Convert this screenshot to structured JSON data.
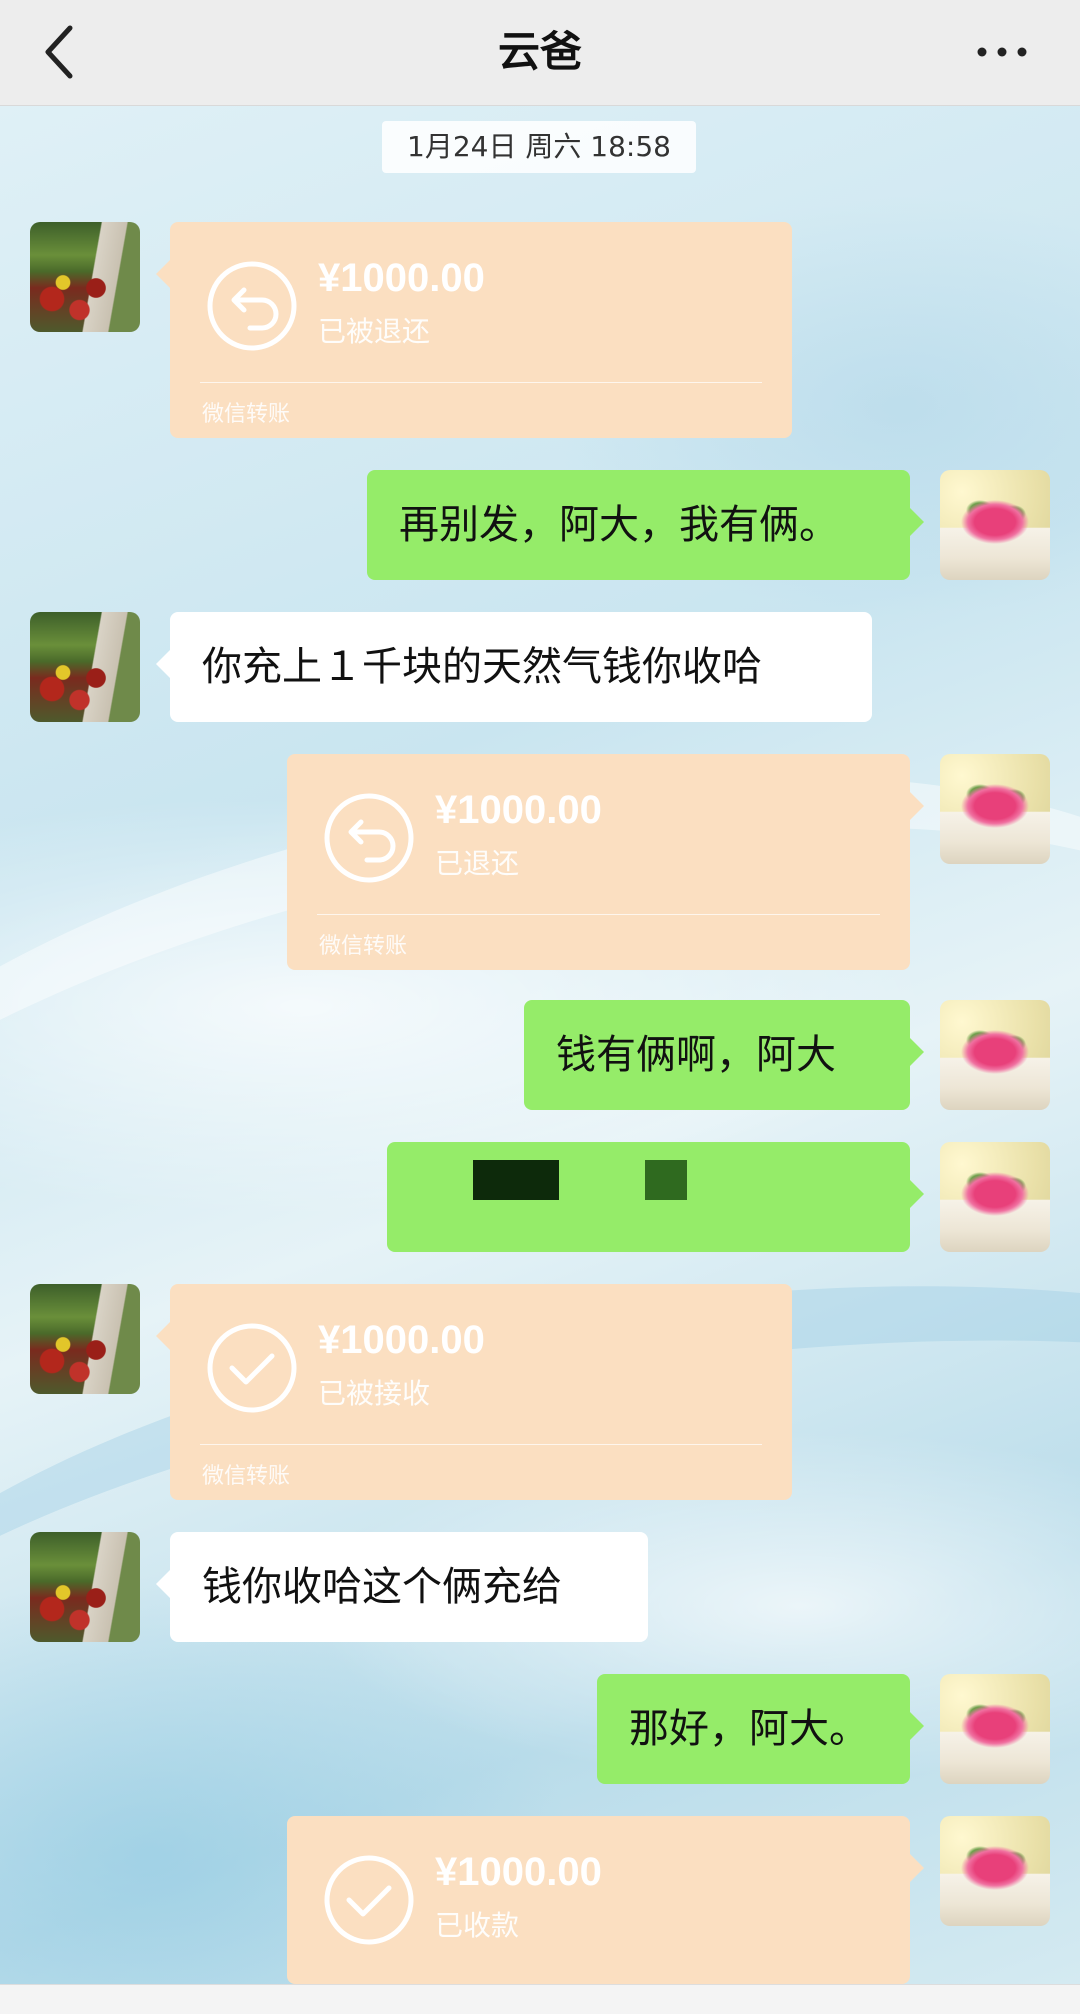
{
  "header": {
    "title": "云爸"
  },
  "timestamp": "1月24日 周六 18:58",
  "messages": [
    {
      "side": "left",
      "type": "transfer",
      "amount": "¥1000.00",
      "status": "已被退还",
      "label": "微信转账",
      "icon": "refund-icon"
    },
    {
      "side": "right",
      "type": "text",
      "text": "再别发，阿大，我有俩。"
    },
    {
      "side": "left",
      "type": "text",
      "text": "你充上１千块的天然气钱你收哈"
    },
    {
      "side": "right",
      "type": "transfer",
      "amount": "¥1000.00",
      "status": "已退还",
      "label": "微信转账",
      "icon": "refund-icon"
    },
    {
      "side": "right",
      "type": "text",
      "text": "钱有俩啊，阿大"
    },
    {
      "side": "right",
      "type": "redacted"
    },
    {
      "side": "left",
      "type": "transfer",
      "amount": "¥1000.00",
      "status": "已被接收",
      "label": "微信转账",
      "icon": "check-icon"
    },
    {
      "side": "left",
      "type": "text",
      "text": "钱你收哈这个俩充给"
    },
    {
      "side": "right",
      "type": "text",
      "text": "那好，阿大。"
    },
    {
      "side": "right",
      "type": "transfer",
      "amount": "¥1000.00",
      "status": "已收款",
      "label": "",
      "icon": "check-icon"
    }
  ],
  "colors": {
    "header_bg": "#ededed",
    "bubble_green": "#95ec69",
    "bubble_white": "#ffffff",
    "transfer_bg": "#fbdfc1"
  }
}
